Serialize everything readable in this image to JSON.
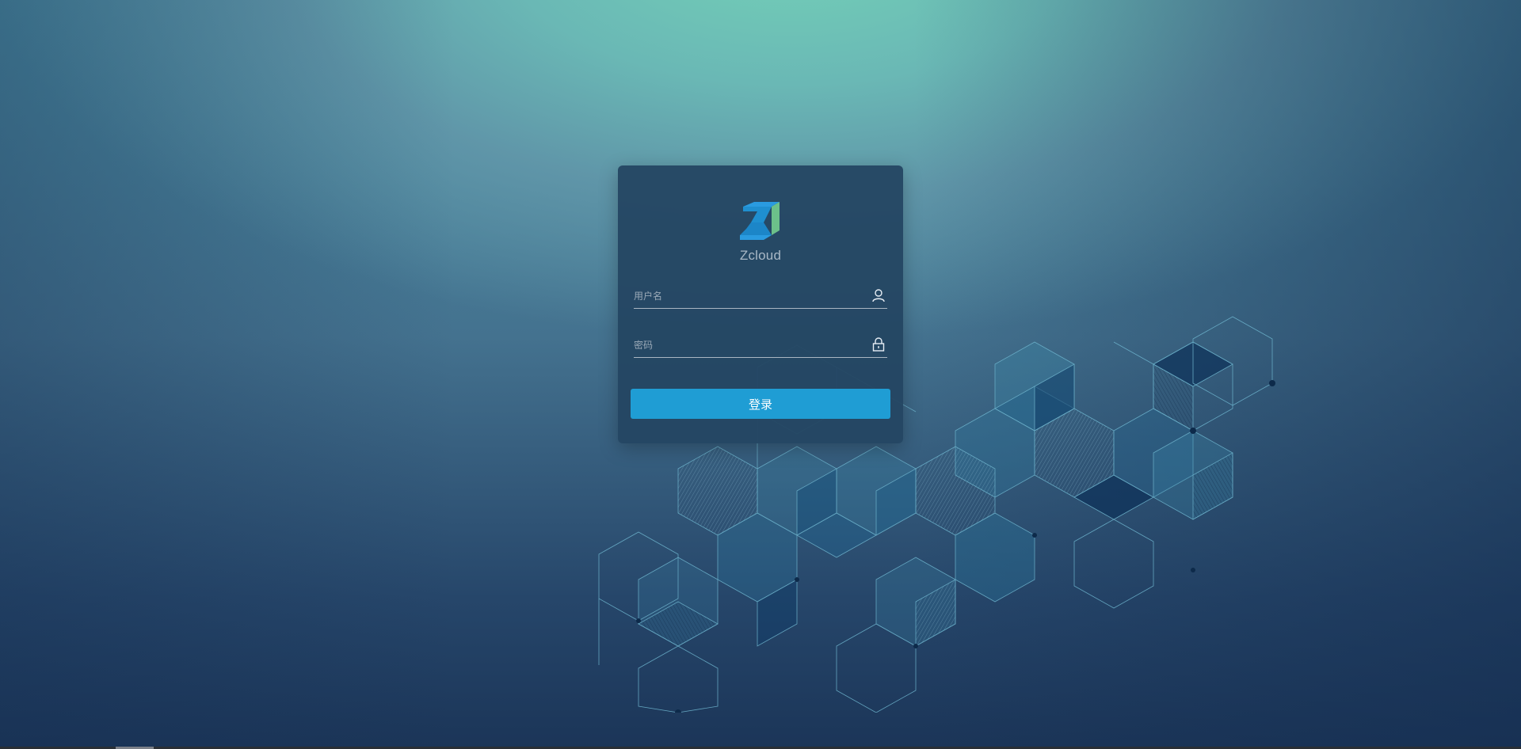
{
  "brand": {
    "logo_icon": "zcloud-cube-logo",
    "name": "Zcloud",
    "colors": {
      "logo_blue": "#1f8fd0",
      "logo_green": "#6cc08a"
    }
  },
  "form": {
    "username": {
      "placeholder": "用户名",
      "value": "",
      "icon": "user-icon"
    },
    "password": {
      "placeholder": "密码",
      "value": "",
      "icon": "lock-icon"
    },
    "submit_label": "登录"
  },
  "theme": {
    "card_bg": "#244662",
    "button_bg": "#1f9dd4",
    "background_top": "#74d2b8",
    "background_bottom": "#1b3558"
  }
}
